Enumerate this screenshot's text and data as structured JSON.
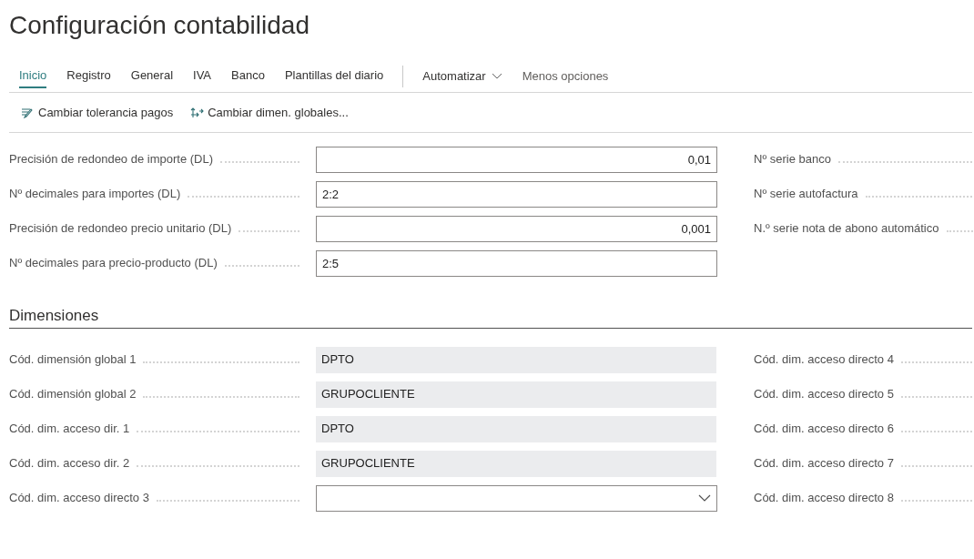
{
  "page_title": "Configuración contabilidad",
  "tabs": [
    {
      "label": "Inicio",
      "selected": true
    },
    {
      "label": "Registro",
      "selected": false
    },
    {
      "label": "General",
      "selected": false
    },
    {
      "label": "IVA",
      "selected": false
    },
    {
      "label": "Banco",
      "selected": false
    },
    {
      "label": "Plantillas del diario",
      "selected": false
    }
  ],
  "menu_automate": {
    "label": "Automatizar"
  },
  "less_options": "Menos opciones",
  "actions": [
    {
      "label": "Cambiar tolerancia pagos",
      "kind": "tolerance"
    },
    {
      "label": "Cambiar dimen. globales...",
      "kind": "dimensions"
    }
  ],
  "general": {
    "left_fields": [
      {
        "label": "Precisión de redondeo de importe (DL)",
        "kind": "number",
        "value": "0,01"
      },
      {
        "label": "Nº decimales para importes (DL)",
        "kind": "text",
        "value": "2:2"
      },
      {
        "label": "Precisión de redondeo precio unitario (DL)",
        "kind": "number",
        "value": "0,001"
      },
      {
        "label": "Nº decimales para precio-producto (DL)",
        "kind": "text",
        "value": "2:5"
      }
    ],
    "right_fields": [
      {
        "label": "Nº serie banco"
      },
      {
        "label": "Nº serie autofactura"
      },
      {
        "label": "N.º serie nota de abono automático"
      }
    ]
  },
  "dimensions": {
    "title": "Dimensiones",
    "left_fields": [
      {
        "label": "Cód. dimensión global 1",
        "kind": "readonly",
        "value": "DPTO"
      },
      {
        "label": "Cód. dimensión global 2",
        "kind": "readonly",
        "value": "GRUPOCLIENTE"
      },
      {
        "label": "Cód. dim. acceso dir. 1",
        "kind": "readonly",
        "value": "DPTO"
      },
      {
        "label": "Cód. dim. acceso dir. 2",
        "kind": "readonly",
        "value": "GRUPOCLIENTE"
      },
      {
        "label": "Cód. dim. acceso directo 3",
        "kind": "select"
      }
    ],
    "right_fields": [
      {
        "label": "Cód. dim. acceso directo 4"
      },
      {
        "label": "Cód. dim. acceso directo 5"
      },
      {
        "label": "Cód. dim. acceso directo 6"
      },
      {
        "label": "Cód. dim. acceso directo 7"
      },
      {
        "label": "Cód. dim. acceso directo 8"
      }
    ]
  }
}
